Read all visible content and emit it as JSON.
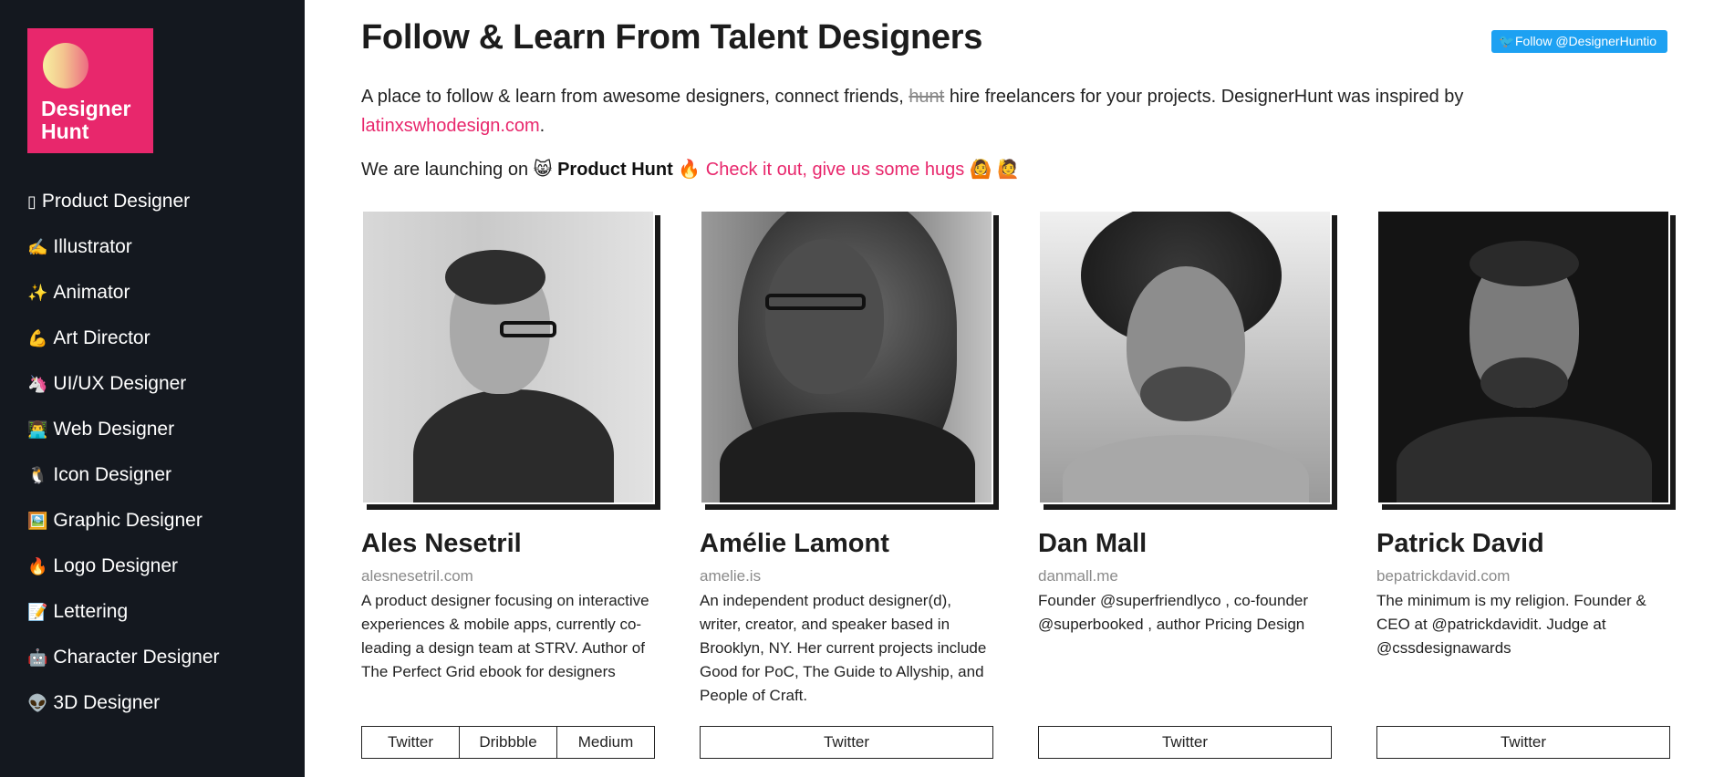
{
  "sidebar": {
    "logo_text": "Designer\nHunt",
    "items": [
      {
        "emoji": "▯",
        "label": "Product Designer"
      },
      {
        "emoji": "✍️",
        "label": "Illustrator"
      },
      {
        "emoji": "✨",
        "label": "Animator"
      },
      {
        "emoji": "💪",
        "label": "Art Director"
      },
      {
        "emoji": "🦄",
        "label": "UI/UX Designer"
      },
      {
        "emoji": "👨‍💻",
        "label": "Web Designer"
      },
      {
        "emoji": "🐧",
        "label": "Icon Designer"
      },
      {
        "emoji": "🖼️",
        "label": "Graphic Designer"
      },
      {
        "emoji": "🔥",
        "label": "Logo Designer"
      },
      {
        "emoji": "📝",
        "label": "Lettering"
      },
      {
        "emoji": "🤖",
        "label": "Character Designer"
      },
      {
        "emoji": "👽",
        "label": "3D Designer"
      }
    ]
  },
  "header": {
    "title": "Follow & Learn From Talent Designers",
    "follow_button": "Follow @DesignerHuntio"
  },
  "intro": {
    "text_before": "A place to follow & learn from awesome designers, connect friends,",
    "struck": "hunt",
    "text_after": "hire freelancers for your projects. DesignerHunt was inspired by",
    "link": "latinxswhodesign.com",
    "period": "."
  },
  "launch": {
    "prefix": "We are launching on",
    "cat_emoji": "😸",
    "product_hunt": "Product Hunt",
    "fire_emoji": "🔥",
    "cta": "Check it out, give us some hugs",
    "emoji_a": "🙆",
    "emoji_b": "🙋"
  },
  "designers": [
    {
      "name": "Ales Nesetril",
      "site": "alesnesetril.com",
      "bio": "A product designer focusing on interactive experiences & mobile apps, currently co-leading a design team at STRV. Author of The Perfect Grid ebook for designers",
      "links": [
        "Twitter",
        "Dribbble",
        "Medium"
      ]
    },
    {
      "name": "Amélie Lamont",
      "site": "amelie.is",
      "bio": "An independent product designer(d), writer, creator, and speaker based in Brooklyn, NY. Her current projects include Good for PoC, The Guide to Allyship, and People of Craft.",
      "links": [
        "Twitter"
      ]
    },
    {
      "name": "Dan Mall",
      "site": "danmall.me",
      "bio": "Founder @superfriendlyco , co-founder @superbooked , author Pricing Design",
      "links": [
        "Twitter"
      ]
    },
    {
      "name": "Patrick David",
      "site": "bepatrickdavid.com",
      "bio": "The minimum is my religion. Founder & CEO at @patrickdavidit. Judge at @cssdesignawards",
      "links": [
        "Twitter"
      ]
    }
  ],
  "colors": {
    "sidebar_bg": "#14181f",
    "brand_pink": "#e8276c",
    "twitter_blue": "#1da1f2"
  }
}
